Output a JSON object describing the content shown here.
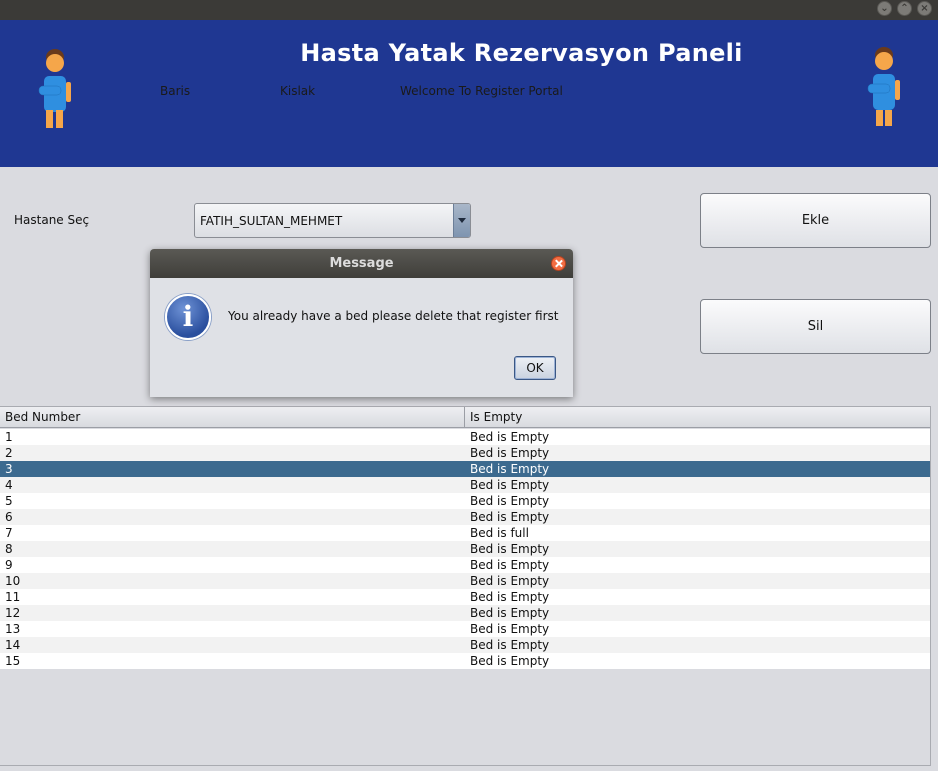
{
  "header": {
    "title": "Hasta Yatak Rezervasyon Paneli",
    "first_name": "Baris",
    "last_name": "Kislak",
    "welcome": "Welcome To Register Portal"
  },
  "form": {
    "hospital_label": "Hastane Seç",
    "hospital_selected": "FATIH_SULTAN_MEHMET",
    "add_button": "Ekle",
    "delete_button": "Sil"
  },
  "table": {
    "columns": [
      "Bed Number",
      "Is Empty"
    ],
    "selected_row": 3,
    "rows": [
      [
        "1",
        "Bed is Empty"
      ],
      [
        "2",
        "Bed is Empty"
      ],
      [
        "3",
        "Bed is Empty"
      ],
      [
        "4",
        "Bed is Empty"
      ],
      [
        "5",
        "Bed is Empty"
      ],
      [
        "6",
        "Bed is Empty"
      ],
      [
        "7",
        "Bed is full"
      ],
      [
        "8",
        "Bed is Empty"
      ],
      [
        "9",
        "Bed is Empty"
      ],
      [
        "10",
        "Bed is Empty"
      ],
      [
        "11",
        "Bed is Empty"
      ],
      [
        "12",
        "Bed is Empty"
      ],
      [
        "13",
        "Bed is Empty"
      ],
      [
        "14",
        "Bed is Empty"
      ],
      [
        "15",
        "Bed is Empty"
      ]
    ]
  },
  "dialog": {
    "title": "Message",
    "message": "You already have a bed please delete that register first",
    "ok_label": "OK",
    "icon": "info-icon"
  },
  "colors": {
    "header_bg": "#1f3792",
    "selected_row": "#3c6a8f",
    "titlebar": "#3b3a37"
  }
}
